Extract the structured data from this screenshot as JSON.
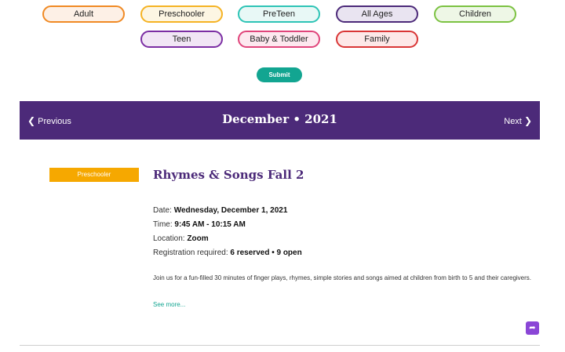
{
  "filters": [
    {
      "label": "Adult",
      "border": "#f08a24",
      "bg": "#fdf0e6"
    },
    {
      "label": "Preschooler",
      "border": "#f5b324",
      "bg": "#fdf6e3"
    },
    {
      "label": "PreTeen",
      "border": "#2ec4b6",
      "bg": "#e8f8f6"
    },
    {
      "label": "All Ages",
      "border": "#4c2a79",
      "bg": "#e9e4f1"
    },
    {
      "label": "Children",
      "border": "#7cc242",
      "bg": "#eef7e6"
    },
    {
      "label": "Teen",
      "border": "#7b2ea3",
      "bg": "#f1e6f5"
    },
    {
      "label": "Baby & Toddler",
      "border": "#e0457b",
      "bg": "#fde8ef"
    },
    {
      "label": "Family",
      "border": "#d93636",
      "bg": "#fde8e8"
    }
  ],
  "submit_label": "Submit",
  "nav": {
    "prev_label": "Previous",
    "month_label": "December • 2021",
    "next_label": "Next"
  },
  "event": {
    "badge": "Preschooler",
    "title": "Rhymes & Songs Fall 2",
    "date_label": "Date: ",
    "date_value": "Wednesday, December 1, 2021",
    "time_label": "Time: ",
    "time_value": "9:45 AM - 10:15 AM",
    "location_label": "Location: ",
    "location_value": "Zoom",
    "registration_label": "Registration required: ",
    "registration_value": "6 reserved • 9 open",
    "description": "Join us for a fun-filled 30 minutes of finger plays, rhymes, simple stories and songs aimed at children from birth to 5 and their caregivers.",
    "see_more": "See more..."
  },
  "colors": {
    "nav_bg": "#4c2a79",
    "accent": "#12a591",
    "badge_bg": "#f6a800",
    "share_bg": "#8a46d6"
  },
  "icons": {
    "prev": "chevron-left-icon",
    "next": "chevron-right-icon",
    "share": "share-icon"
  }
}
